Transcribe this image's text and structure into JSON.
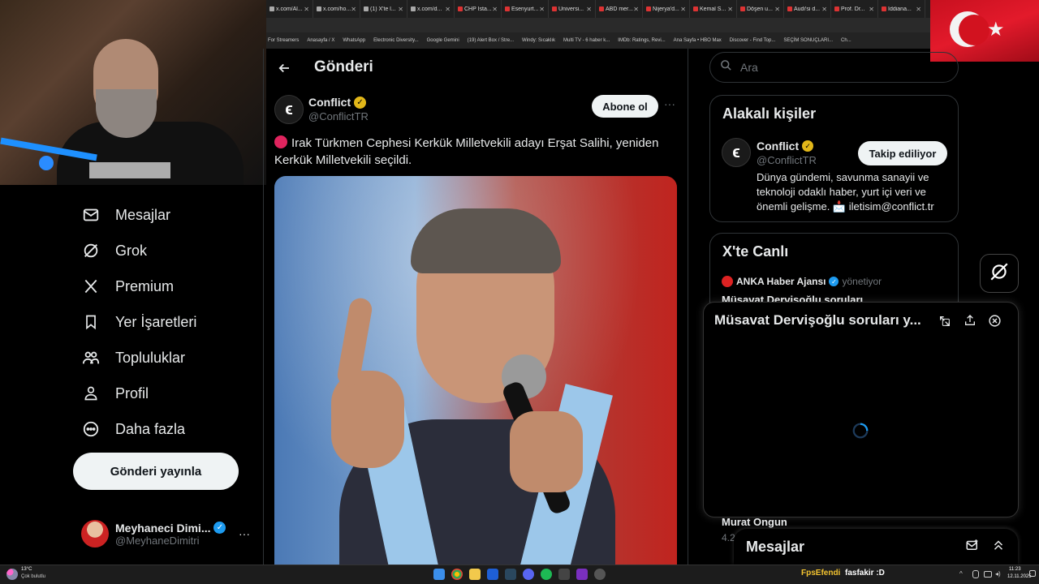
{
  "browser": {
    "tabs": [
      {
        "title": "x.com/Al..."
      },
      {
        "title": "x.com/ho..."
      },
      {
        "title": "(1) X'te l..."
      },
      {
        "title": "x.com/d..."
      },
      {
        "title": "CHP İsta..."
      },
      {
        "title": "Esenyurt..."
      },
      {
        "title": "Üniversi..."
      },
      {
        "title": "ABD mer..."
      },
      {
        "title": "Nijerya'd..."
      },
      {
        "title": "Kemal S..."
      },
      {
        "title": "Döşen u..."
      },
      {
        "title": "Audi'si d..."
      },
      {
        "title": "Prof. Dr..."
      },
      {
        "title": "İddiana..."
      }
    ],
    "bookmarks": [
      "For Streamers",
      "Anasayfa / X",
      "WhatsApp",
      "Electronic Diversity...",
      "Google Gemini",
      "(19) Alert Box / Stre...",
      "Windy: Sıcaklık",
      "Multi TV - 6 haber k...",
      "IMDb: Ratings, Revi...",
      "Ana Sayfa • HBO Max",
      "Discover - Find Top...",
      "SEÇİM SONUÇLARI...",
      "Ch..."
    ]
  },
  "sidebar": {
    "items": [
      {
        "label": "Mesajlar",
        "icon": "envelope-icon"
      },
      {
        "label": "Grok",
        "icon": "grok-icon"
      },
      {
        "label": "Premium",
        "icon": "x-logo-icon"
      },
      {
        "label": "Yer İşaretleri",
        "icon": "bookmark-icon"
      },
      {
        "label": "Topluluklar",
        "icon": "people-icon"
      },
      {
        "label": "Profil",
        "icon": "person-icon"
      },
      {
        "label": "Daha fazla",
        "icon": "more-circle-icon"
      }
    ],
    "post_button": "Gönderi yayınla",
    "account": {
      "name": "Meyhaneci Dimi...",
      "handle": "@MeyhaneDimitri",
      "more": "···"
    }
  },
  "main": {
    "header_title": "Gönderi",
    "tweet": {
      "author_name": "Conflict",
      "author_handle": "@ConflictTR",
      "follow_button": "Abone ol",
      "more": "···",
      "text": "Irak Türkmen Cephesi Kerkük Milletvekili adayı Erşat Salihi, yeniden Kerkük Milletvekili seçildi."
    }
  },
  "right": {
    "search_placeholder": "Ara",
    "related": {
      "title": "Alakalı kişiler",
      "name": "Conflict",
      "handle": "@ConflictTR",
      "button": "Takip ediliyor",
      "bio": "Dünya gündemi, savunma sanayii ve teknoloji odaklı haber, yurt içi veri ve önemli gelişme. 📩 iletisim@conflict.tr"
    },
    "live": {
      "title": "X'te Canlı",
      "host": "ANKA Haber Ajansı",
      "host_role": "yönetiyor",
      "stream_title": "Müsavat Dervişoğlu soruları..."
    },
    "popup_title": "Müsavat Dervişoğlu soruları y...",
    "under_popup_name": "Murat Ongun",
    "under_popup_meta": "4.2",
    "messages_bar": "Mesajlar"
  },
  "taskbar": {
    "weather_temp": "13°C",
    "weather_desc": "Çok bulutlu",
    "chat_user": "FpsEfendi",
    "chat_msg": "fasfakir :D",
    "time": "11:23",
    "date": "12.11.2025"
  },
  "colors": {
    "accent_blue": "#1d9bf0",
    "verified_gold": "#e2b719",
    "red_dot": "#e0245e",
    "chat_user_color": "#f4c430"
  }
}
